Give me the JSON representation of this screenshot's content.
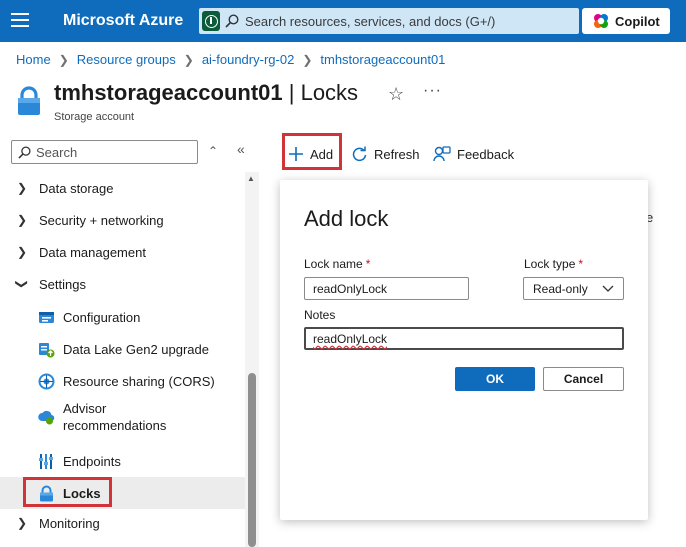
{
  "header": {
    "brand": "Microsoft Azure",
    "search_placeholder": "Search resources, services, and docs (G+/)",
    "copilot_label": "Copilot"
  },
  "breadcrumb": [
    "Home",
    "Resource groups",
    "ai-foundry-rg-02",
    "tmhstorageaccount01"
  ],
  "page": {
    "title_resource": "tmhstorageaccount01",
    "title_suffix": "| Locks",
    "subtitle": "Storage account"
  },
  "sidebar": {
    "search_placeholder": "Search",
    "sections": [
      {
        "label": "Data storage",
        "expanded": false
      },
      {
        "label": "Security + networking",
        "expanded": false
      },
      {
        "label": "Data management",
        "expanded": false
      },
      {
        "label": "Settings",
        "expanded": true
      }
    ],
    "settings_items": [
      {
        "label": "Configuration",
        "icon": "configuration-icon"
      },
      {
        "label": "Data Lake Gen2 upgrade",
        "icon": "data-lake-icon"
      },
      {
        "label": "Resource sharing (CORS)",
        "icon": "cors-icon"
      },
      {
        "label_line1": "Advisor",
        "label_line2": "recommendations",
        "icon": "advisor-icon"
      },
      {
        "label": "Endpoints",
        "icon": "endpoints-icon"
      },
      {
        "label": "Locks",
        "icon": "lock-icon",
        "active": true
      }
    ],
    "after": {
      "label": "Monitoring",
      "expanded": false
    }
  },
  "toolbar": {
    "add_label": "Add",
    "refresh_label": "Refresh",
    "feedback_label": "Feedback"
  },
  "background_partial_text": "e",
  "dialog": {
    "title": "Add lock",
    "lock_name_label": "Lock name",
    "lock_name_value": "readOnlyLock",
    "lock_type_label": "Lock type",
    "lock_type_value": "Read-only",
    "notes_label": "Notes",
    "notes_value": "readOnlyLock",
    "required_mark": "*",
    "ok_label": "OK",
    "cancel_label": "Cancel"
  },
  "colors": {
    "azure_blue": "#0f6cbd",
    "highlight_red": "#d13438",
    "required_red": "#c50f1f"
  }
}
